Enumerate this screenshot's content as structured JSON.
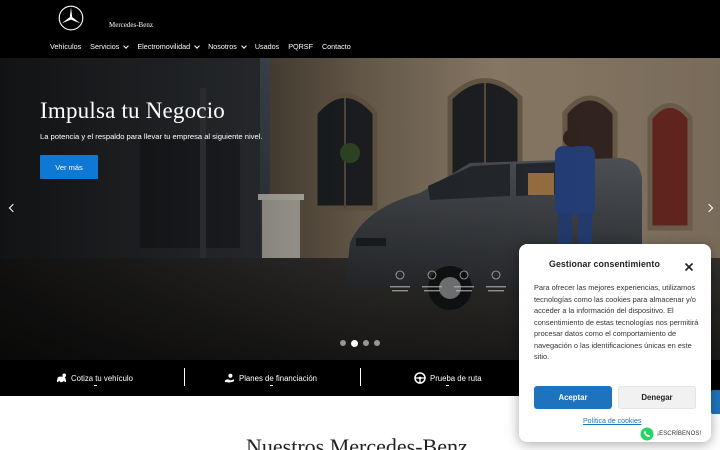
{
  "header": {
    "brand": "Mercedes-Benz",
    "nav": [
      {
        "label": "Vehículos",
        "dropdown": false
      },
      {
        "label": "Servicios",
        "dropdown": true
      },
      {
        "label": "Electromovilidad",
        "dropdown": true
      },
      {
        "label": "Nosotros",
        "dropdown": true
      },
      {
        "label": "Usados",
        "dropdown": false
      },
      {
        "label": "PQRSF",
        "dropdown": false
      },
      {
        "label": "Contacto",
        "dropdown": false
      }
    ]
  },
  "hero": {
    "title": "Impulsa tu Negocio",
    "subtitle": "La potencia y el respaldo para llevar tu empresa al siguiente nivel.",
    "button_label": "Ver más",
    "slides_count": 4,
    "active_slide": 2
  },
  "actions": [
    {
      "label": "Cotiza tu vehículo",
      "icon": "car-quote-icon"
    },
    {
      "label": "Planes de financiación",
      "icon": "hand-coin-icon"
    },
    {
      "label": "Prueba de ruta",
      "icon": "steering-wheel-icon"
    }
  ],
  "section": {
    "title": "Nuestros Mercedes-Benz"
  },
  "consent": {
    "title": "Gestionar consentimiento",
    "text": "Para ofrecer las mejores experiencias, utilizamos tecnologías como las cookies para almacenar y/o acceder a la información del dispositivo. El consentimiento de estas tecnologías nos permitirá procesar datos como el comportamiento de navegación o las identificaciones únicas en este sitio.",
    "accept_label": "Aceptar",
    "deny_label": "Denegar",
    "policy_label": "Política de cookies"
  },
  "whatsapp": {
    "label": "¡ESCRÍBENOS!"
  },
  "colors": {
    "primary_blue": "#0f78d4",
    "consent_blue": "#1e73be",
    "whatsapp_green": "#25d366"
  }
}
